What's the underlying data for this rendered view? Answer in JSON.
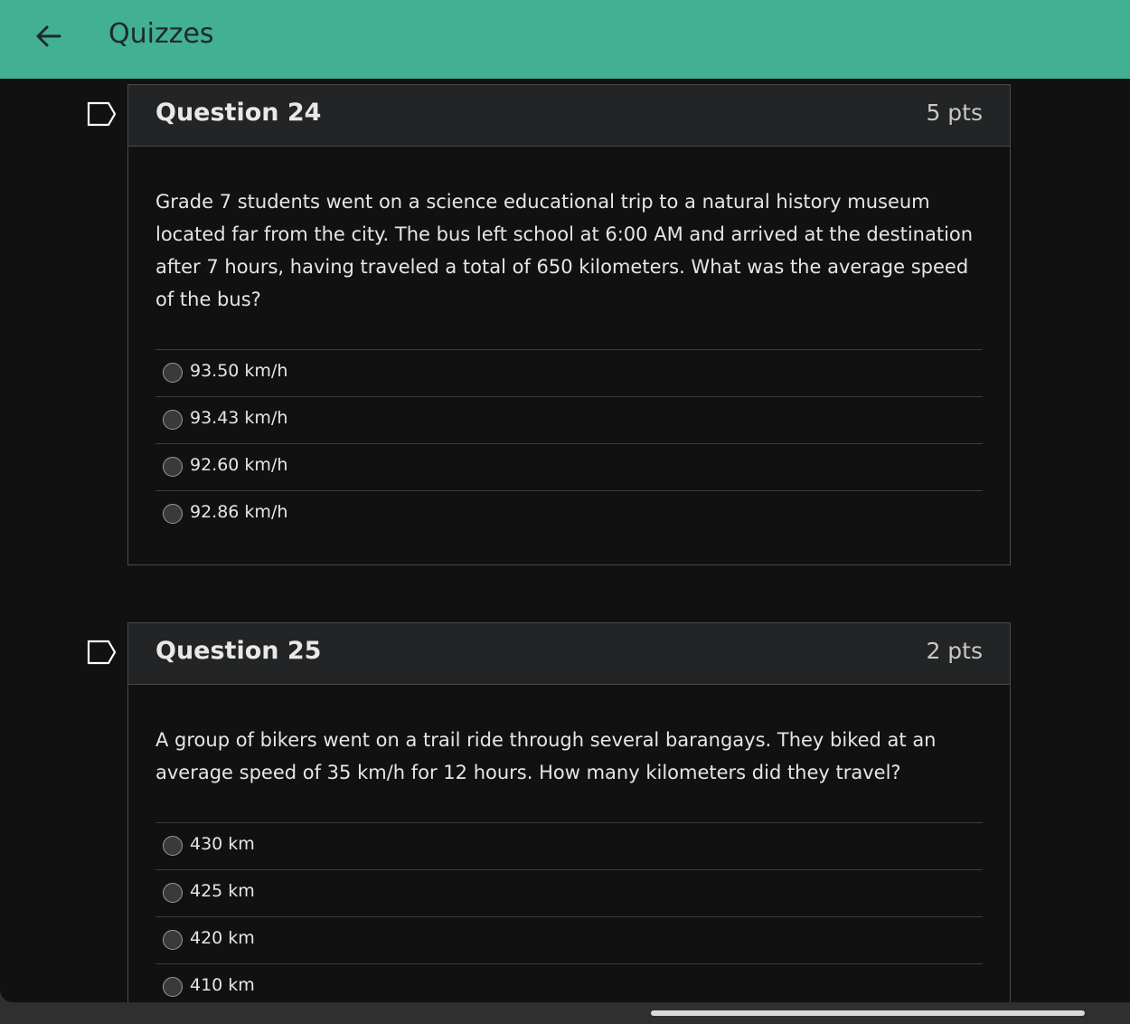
{
  "header": {
    "title": "Quizzes",
    "back_icon": "arrow-left-icon",
    "background": "#41b093"
  },
  "questions": [
    {
      "title": "Question 24",
      "points": "5 pts",
      "text": "Grade 7 students went on a science educational trip to a natural history museum located far from the city. The bus left school at 6:00 AM and arrived at the destination after 7 hours, having traveled a total of 650 kilometers. What was the average speed of the bus?",
      "answers": [
        "93.50 km/h",
        "93.43 km/h",
        "92.60 km/h",
        "92.86 km/h"
      ]
    },
    {
      "title": "Question 25",
      "points": "2 pts",
      "text": "A group of bikers went on a trail ride through several barangays. They biked at an average speed of 35 km/h for 12 hours. How many kilometers did they travel?",
      "answers": [
        "430 km",
        "425 km",
        "420 km",
        "410 km"
      ]
    }
  ]
}
